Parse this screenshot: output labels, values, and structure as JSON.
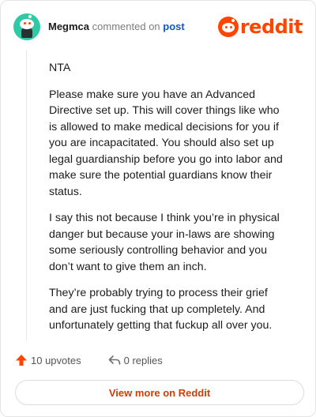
{
  "comment": {
    "username": "Megmca",
    "verb": "commented on",
    "post_link": "post",
    "paragraphs": [
      "NTA",
      "Please make sure you have an Advanced Directive set up. This will cover things like who is allowed to make medical decisions for you if you are incapacitated. You should also set up legal guardianship before you go into labor and make sure the potential guardians know their status.",
      "I say this not because I think you’re in physical danger but because your in-laws are showing some seriously controlling behavior and you don’t want to give them an inch.",
      "They’re probably trying to process their grief and are just fucking that up completely. And unfortunately getting that fuckup all over you."
    ]
  },
  "brand": {
    "name": "reddit",
    "color": "#ff4500"
  },
  "actions": {
    "upvotes": "10 upvotes",
    "replies": "0 replies"
  },
  "footer": {
    "view_more": "View more on Reddit"
  },
  "icons": {
    "avatar": "snoo-avatar-icon",
    "logo": "reddit-logo-icon",
    "upvote": "upvote-arrow-icon",
    "reply": "reply-arrow-icon"
  }
}
